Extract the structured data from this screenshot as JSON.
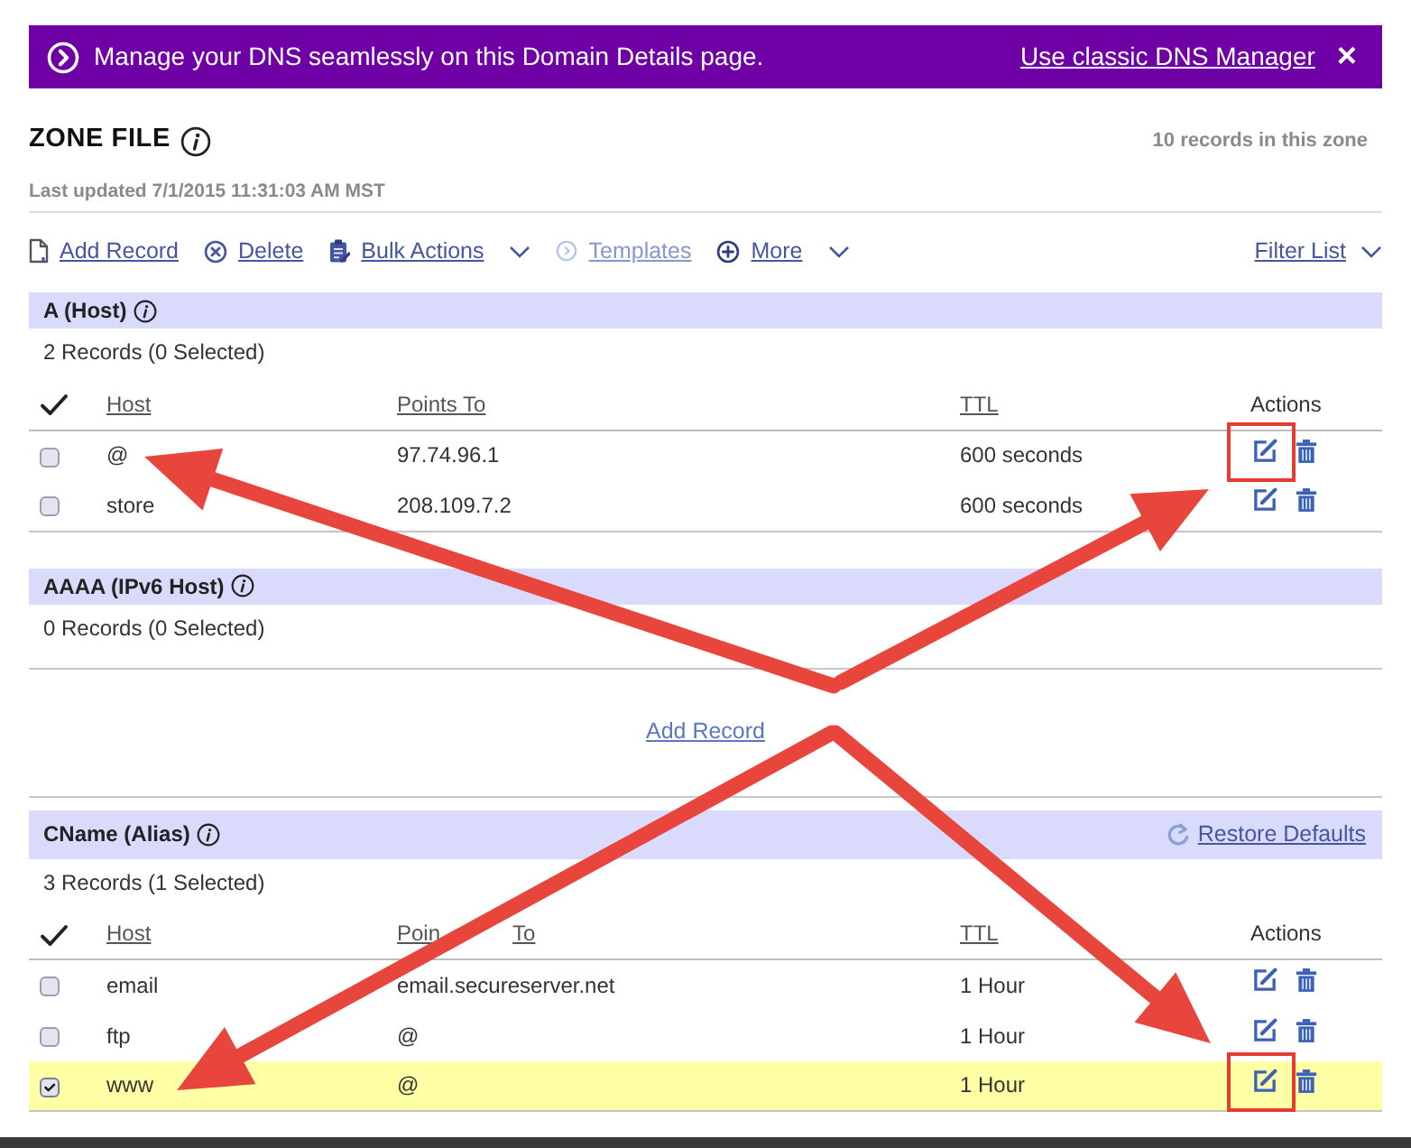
{
  "banner": {
    "message": "Manage your DNS seamlessly on this Domain Details page.",
    "link": "Use classic DNS Manager",
    "close": "×"
  },
  "zone": {
    "title": "ZONE FILE",
    "record_total": "10 records in this zone",
    "last_updated": "Last updated 7/1/2015 11:31:03 AM MST"
  },
  "toolbar": {
    "actions": [
      {
        "kind": "add",
        "label": "Add Record",
        "disabled": false,
        "dropdown": false
      },
      {
        "kind": "delete",
        "label": "Delete",
        "disabled": false,
        "dropdown": false
      },
      {
        "kind": "bulk",
        "label": "Bulk Actions",
        "disabled": false,
        "dropdown": true
      },
      {
        "kind": "template",
        "label": "Templates",
        "disabled": true,
        "dropdown": false
      },
      {
        "kind": "more",
        "label": "More",
        "disabled": false,
        "dropdown": true
      }
    ],
    "filter": {
      "label": "Filter List"
    }
  },
  "sections": [
    {
      "title": "A (Host)",
      "summary": "2 Records (0 Selected)",
      "columns": [
        {
          "label": "Host",
          "sortable": true
        },
        {
          "label": "Points To",
          "sortable": true
        },
        {
          "label": "TTL",
          "sortable": true
        },
        {
          "label": "Actions",
          "sortable": false
        }
      ],
      "rows": [
        {
          "host": "@",
          "points_to": "97.74.96.1",
          "ttl": "600 seconds",
          "selected": false,
          "marked": true
        },
        {
          "host": "store",
          "points_to": "208.109.7.2",
          "ttl": "600 seconds",
          "selected": false,
          "marked": false
        }
      ]
    },
    {
      "title": "AAAA (IPv6 Host)",
      "summary": "0 Records (0 Selected)",
      "add_link": "Add Record"
    },
    {
      "title": "CName (Alias)",
      "restore_link": "Restore Defaults",
      "summary": "3 Records (1 Selected)",
      "columns": [
        {
          "label": "Host",
          "sortable": true
        },
        {
          "label": "Poin",
          "tail": "To",
          "sortable": true
        },
        {
          "label": "TTL",
          "sortable": true
        },
        {
          "label": "Actions",
          "sortable": false
        }
      ],
      "rows": [
        {
          "host": "email",
          "points_to": "email.secureserver.net",
          "ttl": "1 Hour",
          "selected": false,
          "marked": false
        },
        {
          "host": "ftp",
          "points_to": "@",
          "ttl": "1 Hour",
          "selected": false,
          "marked": false
        },
        {
          "host": "www",
          "points_to": "@",
          "ttl": "1 Hour",
          "selected": true,
          "marked": true
        }
      ]
    }
  ]
}
